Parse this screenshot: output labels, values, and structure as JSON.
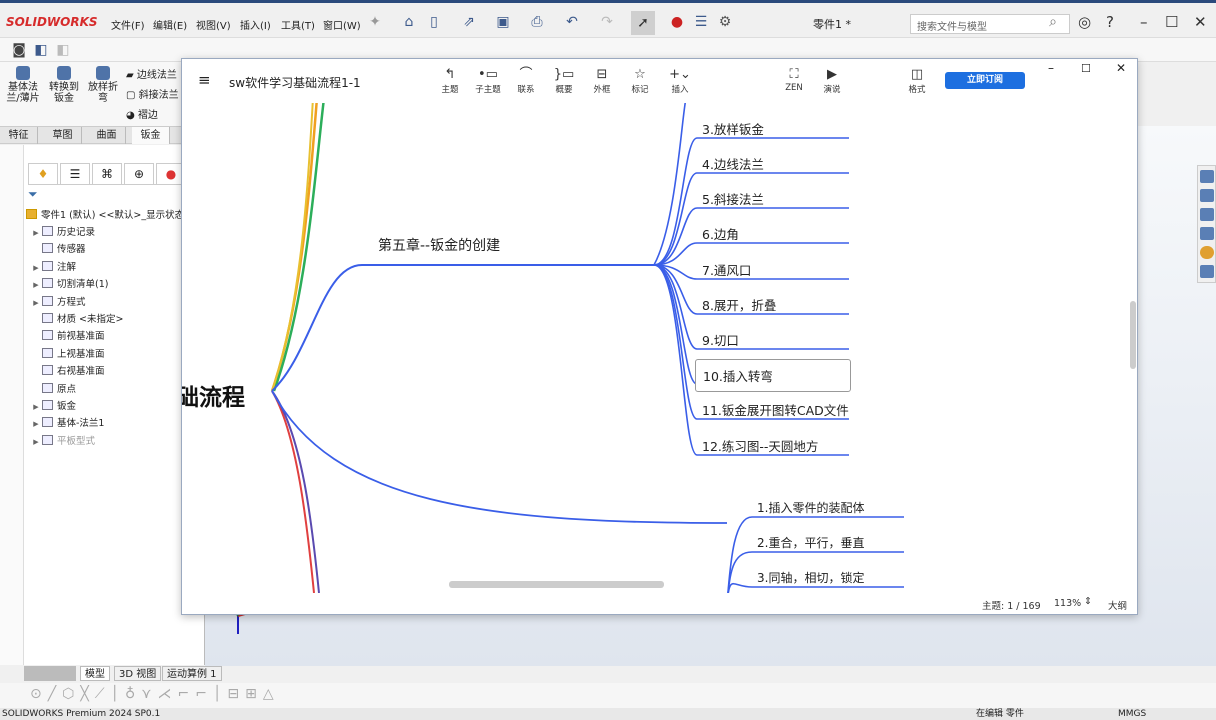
{
  "app": {
    "logo": "SOLIDWORKS",
    "menus": [
      "文件(F)",
      "编辑(E)",
      "视图(V)",
      "插入(I)",
      "工具(T)",
      "窗口(W)"
    ],
    "doc_title": "零件1 *",
    "search_placeholder": "搜索文件与模型"
  },
  "ribbon": {
    "buttons": [
      "基体法兰/薄片",
      "转换到钣金",
      "放样折弯"
    ],
    "small": [
      "边线法兰",
      "斜接法兰",
      "褶边"
    ]
  },
  "cmd_tabs": [
    "特征",
    "草图",
    "曲面",
    "钣金"
  ],
  "tree": {
    "root": "零件1 (默认) <<默认>_显示状态",
    "items": [
      {
        "label": "历史记录",
        "arrow": true
      },
      {
        "label": "传感器",
        "arrow": false
      },
      {
        "label": "注解",
        "arrow": true
      },
      {
        "label": "切割清单(1)",
        "arrow": true
      },
      {
        "label": "方程式",
        "arrow": true
      },
      {
        "label": "材质 <未指定>",
        "arrow": false
      },
      {
        "label": "前视基准面",
        "arrow": false
      },
      {
        "label": "上视基准面",
        "arrow": false
      },
      {
        "label": "右视基准面",
        "arrow": false
      },
      {
        "label": "原点",
        "arrow": false
      },
      {
        "label": "钣金",
        "arrow": true
      },
      {
        "label": "基体-法兰1",
        "arrow": true
      },
      {
        "label": "平板型式",
        "arrow": true
      }
    ]
  },
  "bottom_tabs": [
    "模型",
    "3D 视图",
    "运动算例 1"
  ],
  "status": {
    "left": "SOLIDWORKS Premium 2024 SP0.1",
    "editing": "在编辑 零件",
    "units": "MMGS"
  },
  "mindmap": {
    "title": "sw软件学习基础流程1-1",
    "tools": [
      {
        "label": "主题",
        "icon": "↰"
      },
      {
        "label": "子主题",
        "icon": "•▭"
      },
      {
        "label": "联系",
        "icon": "⌒"
      },
      {
        "label": "概要",
        "icon": "}▭"
      },
      {
        "label": "外框",
        "icon": "⊟"
      },
      {
        "label": "标记",
        "icon": "☆"
      },
      {
        "label": "插入",
        "icon": "+⌄"
      }
    ],
    "tools_right": [
      {
        "label": "ZEN",
        "icon": "⛶"
      },
      {
        "label": "演说",
        "icon": "▶"
      },
      {
        "label": "格式",
        "icon": "◫"
      }
    ],
    "subscribe": "立即订阅",
    "root": "础流程",
    "chapter": "第五章--钣金的创建",
    "items": [
      "3.放样钣金",
      "4.边线法兰",
      "5.斜接法兰",
      "6.边角",
      "7.通风口",
      "8.展开，折叠",
      "9.切口",
      "10.插入转弯",
      "11.钣金展开图转CAD文件",
      "12.练习图--天圆地方"
    ],
    "selected_index": 7,
    "items2": [
      "1.插入零件的装配体",
      "2.重合，平行，垂直",
      "3.同轴，相切，锁定"
    ],
    "footer": {
      "topic": "主题: 1 / 169",
      "zoom": "113%",
      "outline": "大纲"
    },
    "colors": {
      "branch": "#3a5ee8",
      "orange": "#f0a020",
      "green": "#2cae5a",
      "red": "#e04040",
      "purple": "#5a4ab0"
    }
  }
}
